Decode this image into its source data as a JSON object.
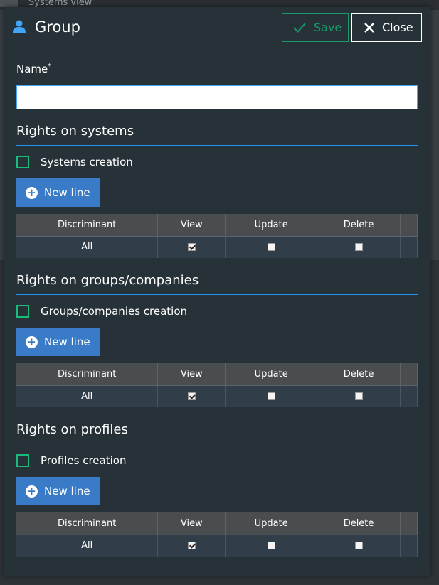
{
  "background": {
    "top_label": "Systems view"
  },
  "dialog": {
    "title": "Group",
    "save_label": "Save",
    "close_label": "Close"
  },
  "name_field": {
    "label": "Name",
    "required_mark": "*",
    "value": ""
  },
  "table_headers": {
    "discriminant": "Discriminant",
    "view": "View",
    "update": "Update",
    "delete": "Delete"
  },
  "sections": [
    {
      "title": "Rights on systems",
      "creation_label": "Systems creation",
      "creation_checked": false,
      "new_line_label": "New line",
      "rows": [
        {
          "discriminant": "All",
          "view": true,
          "update": false,
          "delete": false
        }
      ]
    },
    {
      "title": "Rights on groups/companies",
      "creation_label": "Groups/companies creation",
      "creation_checked": false,
      "new_line_label": "New line",
      "rows": [
        {
          "discriminant": "All",
          "view": true,
          "update": false,
          "delete": false
        }
      ]
    },
    {
      "title": "Rights on profiles",
      "creation_label": "Profiles creation",
      "creation_checked": false,
      "new_line_label": "New line",
      "rows": [
        {
          "discriminant": "All",
          "view": true,
          "update": false,
          "delete": false
        }
      ]
    }
  ],
  "colors": {
    "dialog_bg": "#263238",
    "accent_blue": "#2196f3",
    "button_blue": "#3a7bc8",
    "save_green": "#1a9a6c",
    "checkbox_green": "#1abc7c"
  },
  "icons": {
    "title": "user-icon",
    "save": "check-icon",
    "close": "close-icon",
    "new_line": "plus-circle-icon"
  }
}
